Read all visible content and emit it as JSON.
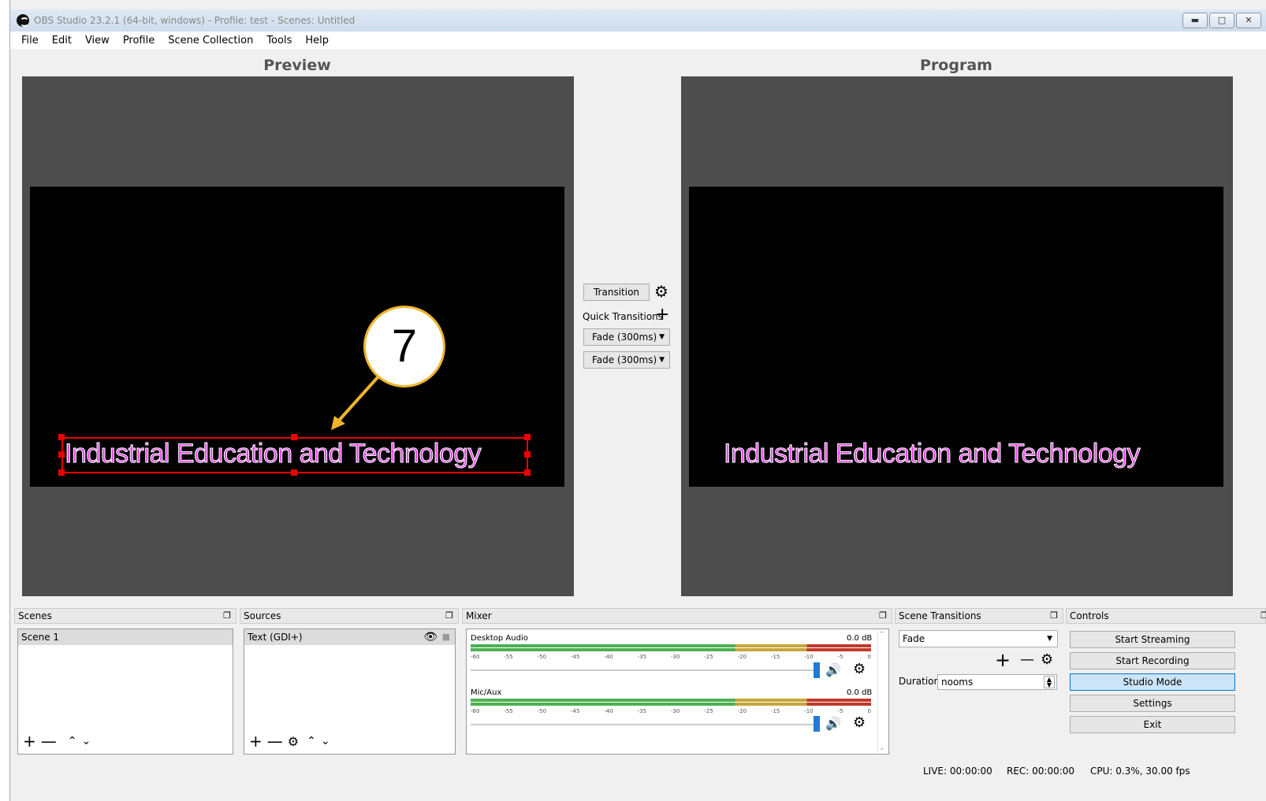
{
  "window": {
    "title": "OBS Studio 23.2.1 (64-bit, windows) - Profile: test - Scenes: Untitled",
    "controls": [
      "minimize",
      "maximize",
      "close"
    ]
  },
  "menu": [
    "File",
    "Edit",
    "View",
    "Profile",
    "Scene Collection",
    "Tools",
    "Help"
  ],
  "preview": {
    "title": "Preview",
    "text": "Industrial Education and Technology",
    "callout": "7"
  },
  "program": {
    "title": "Program",
    "text": "Industrial Education and Technology"
  },
  "transitions_panel": {
    "transition_button": "Transition",
    "quick_transitions_label": "Quick Transitions",
    "fade1": "Fade (300ms)",
    "fade2": "Fade (300ms)"
  },
  "docks": {
    "scenes": {
      "title": "Scenes",
      "items": [
        "Scene 1"
      ]
    },
    "sources": {
      "title": "Sources",
      "items": [
        "Text (GDI+)"
      ]
    },
    "mixer": {
      "title": "Mixer",
      "channels": [
        {
          "name": "Desktop Audio",
          "level": "0.0 dB"
        },
        {
          "name": "Mic/Aux",
          "level": "0.0 dB"
        }
      ],
      "scale": [
        "-60",
        "-55",
        "-50",
        "-45",
        "-40",
        "-35",
        "-30",
        "-25",
        "-20",
        "-15",
        "-10",
        "-5",
        "0"
      ]
    },
    "scene_transitions": {
      "title": "Scene Transitions",
      "selected": "Fade",
      "duration_label": "Duration",
      "duration_value": "nooms"
    },
    "controls": {
      "title": "Controls",
      "start_streaming": "Start Streaming",
      "start_recording": "Start Recording",
      "studio_mode": "Studio Mode",
      "settings": "Settings",
      "exit": "Exit"
    }
  },
  "status": {
    "live": "LIVE: 00:00:00",
    "rec": "REC: 00:00:00",
    "cpu": "CPU: 0.3%, 30.00 fps"
  },
  "colors": {
    "text_fill": "#e53ee5",
    "selection": "#ee0000",
    "callout_border": "#f0b52a",
    "studio_mode_active": "#cce4f7"
  }
}
